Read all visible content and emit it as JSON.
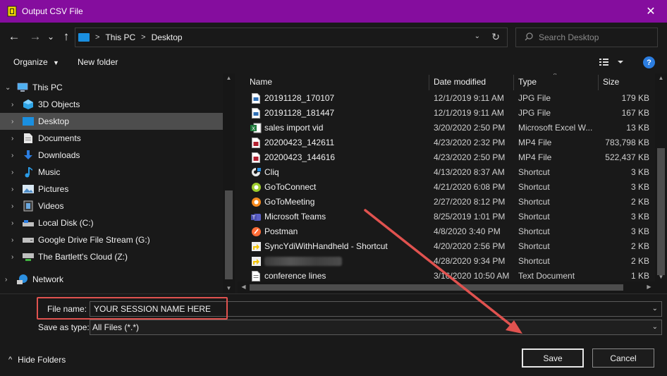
{
  "window": {
    "title": "Output CSV File",
    "close_glyph": "✕"
  },
  "nav": {
    "back_glyph": "←",
    "forward_glyph": "→",
    "recent_glyph": "⌄",
    "up_glyph": "↑",
    "breadcrumb": [
      "This PC",
      "Desktop"
    ],
    "crumb_sep": ">",
    "search_placeholder": "Search Desktop"
  },
  "commands": {
    "organize": "Organize",
    "new_folder": "New folder",
    "help": "?"
  },
  "tree": [
    {
      "label": "This PC",
      "icon": "pc-icon"
    },
    {
      "label": "3D Objects",
      "icon": "3d-objects-icon"
    },
    {
      "label": "Desktop",
      "icon": "desktop-icon"
    },
    {
      "label": "Documents",
      "icon": "documents-icon"
    },
    {
      "label": "Downloads",
      "icon": "downloads-icon"
    },
    {
      "label": "Music",
      "icon": "music-icon"
    },
    {
      "label": "Pictures",
      "icon": "pictures-icon"
    },
    {
      "label": "Videos",
      "icon": "videos-icon"
    },
    {
      "label": "Local Disk (C:)",
      "icon": "local-disk-icon"
    },
    {
      "label": "Google Drive File Stream (G:)",
      "icon": "drive-icon"
    },
    {
      "label": "The Bartlett's Cloud (Z:)",
      "icon": "network-drive-icon"
    },
    {
      "label": "Network",
      "icon": "network-icon"
    }
  ],
  "columns": [
    "Name",
    "Date modified",
    "Type",
    "Size"
  ],
  "files": [
    {
      "name": "20191128_170107",
      "date": "12/1/2019 9:11 AM",
      "type": "JPG File",
      "size": "179 KB",
      "icon": "image-file-icon"
    },
    {
      "name": "20191128_181447",
      "date": "12/1/2019 9:11 AM",
      "type": "JPG File",
      "size": "167 KB",
      "icon": "image-file-icon"
    },
    {
      "name": "sales import vid",
      "date": "3/20/2020 2:50 PM",
      "type": "Microsoft Excel W...",
      "size": "13 KB",
      "icon": "excel-file-icon"
    },
    {
      "name": "20200423_142611",
      "date": "4/23/2020 2:32 PM",
      "type": "MP4 File",
      "size": "783,798 KB",
      "icon": "video-file-icon"
    },
    {
      "name": "20200423_144616",
      "date": "4/23/2020 2:50 PM",
      "type": "MP4 File",
      "size": "522,437 KB",
      "icon": "video-file-icon"
    },
    {
      "name": "Cliq",
      "date": "4/13/2020 8:37 AM",
      "type": "Shortcut",
      "size": "3 KB",
      "icon": "cliq-icon"
    },
    {
      "name": "GoToConnect",
      "date": "4/21/2020 6:08 PM",
      "type": "Shortcut",
      "size": "3 KB",
      "icon": "gotoconnect-icon"
    },
    {
      "name": "GoToMeeting",
      "date": "2/27/2020 8:12 PM",
      "type": "Shortcut",
      "size": "2 KB",
      "icon": "gotomeeting-icon"
    },
    {
      "name": "Microsoft Teams",
      "date": "8/25/2019 1:01 PM",
      "type": "Shortcut",
      "size": "3 KB",
      "icon": "teams-icon"
    },
    {
      "name": "Postman",
      "date": "4/8/2020 3:40 PM",
      "type": "Shortcut",
      "size": "3 KB",
      "icon": "postman-icon"
    },
    {
      "name": "SyncYdiWithHandheld - Shortcut",
      "date": "4/20/2020 2:56 PM",
      "type": "Shortcut",
      "size": "2 KB",
      "icon": "shortcut-icon"
    },
    {
      "name": "",
      "date": "4/28/2020 9:34 PM",
      "type": "Shortcut",
      "size": "2 KB",
      "icon": "shortcut-icon",
      "blurred": true
    },
    {
      "name": "conference lines",
      "date": "3/16/2020 10:50 AM",
      "type": "Text Document",
      "size": "1 KB",
      "icon": "text-file-icon"
    }
  ],
  "bottom": {
    "file_name_label": "File name:",
    "file_name_value": "YOUR SESSION NAME HERE",
    "save_as_type_label": "Save as type:",
    "save_as_type_value": "All Files (*.*)",
    "hide_folders": "Hide Folders",
    "save": "Save",
    "cancel": "Cancel"
  },
  "colors": {
    "titlebar": "#850d9e",
    "annotation": "#e0524f",
    "accent_blue": "#2b7de0"
  }
}
